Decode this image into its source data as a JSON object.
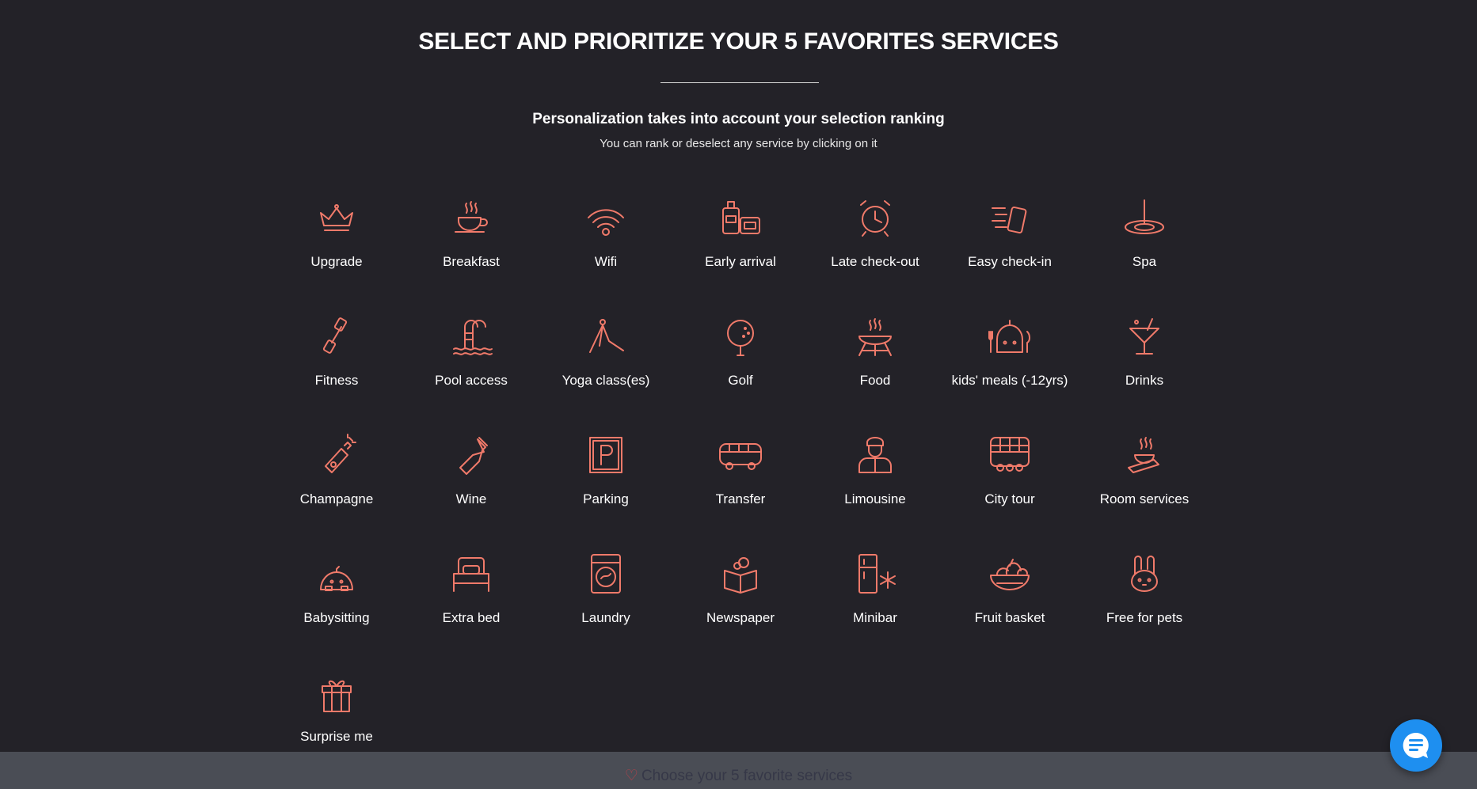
{
  "header": {
    "title": "SELECT AND PRIORITIZE YOUR 5 FAVORITES SERVICES",
    "subtitle": "Personalization takes into account your selection ranking",
    "hint": "You can rank or deselect any service by clicking on it"
  },
  "accent": "#f07a6a",
  "services": [
    {
      "label": "Upgrade",
      "icon": "crown-icon"
    },
    {
      "label": "Breakfast",
      "icon": "coffee-cup-icon"
    },
    {
      "label": "Wifi",
      "icon": "wifi-icon"
    },
    {
      "label": "Early arrival",
      "icon": "luggage-icon"
    },
    {
      "label": "Late check-out",
      "icon": "alarm-clock-icon"
    },
    {
      "label": "Easy check-in",
      "icon": "fast-luggage-icon"
    },
    {
      "label": "Spa",
      "icon": "water-drop-icon"
    },
    {
      "label": "Fitness",
      "icon": "dumbbell-icon"
    },
    {
      "label": "Pool access",
      "icon": "pool-ladder-icon"
    },
    {
      "label": "Yoga class(es)",
      "icon": "yoga-icon"
    },
    {
      "label": "Golf",
      "icon": "golf-ball-icon"
    },
    {
      "label": "Food",
      "icon": "barbecue-icon"
    },
    {
      "label": "kids' meals (-12yrs)",
      "icon": "kids-meal-icon"
    },
    {
      "label": "Drinks",
      "icon": "cocktail-icon"
    },
    {
      "label": "Champagne",
      "icon": "champagne-icon"
    },
    {
      "label": "Wine",
      "icon": "wine-bottle-icon"
    },
    {
      "label": "Parking",
      "icon": "parking-icon"
    },
    {
      "label": "Transfer",
      "icon": "bus-icon"
    },
    {
      "label": "Limousine",
      "icon": "chauffeur-icon"
    },
    {
      "label": "City tour",
      "icon": "double-decker-bus-icon"
    },
    {
      "label": "Room services",
      "icon": "room-service-icon"
    },
    {
      "label": "Babysitting",
      "icon": "baby-icon"
    },
    {
      "label": "Extra bed",
      "icon": "bed-icon"
    },
    {
      "label": "Laundry",
      "icon": "washing-machine-icon"
    },
    {
      "label": "Newspaper",
      "icon": "newspaper-icon"
    },
    {
      "label": "Minibar",
      "icon": "fridge-icon"
    },
    {
      "label": "Fruit basket",
      "icon": "fruit-basket-icon"
    },
    {
      "label": "Free for pets",
      "icon": "pet-icon"
    },
    {
      "label": "Surprise me",
      "icon": "gift-icon"
    }
  ],
  "footer": {
    "text": "Choose your 5 favorite services",
    "icon": "heart-icon"
  },
  "chat": {
    "icon": "chat-icon"
  }
}
